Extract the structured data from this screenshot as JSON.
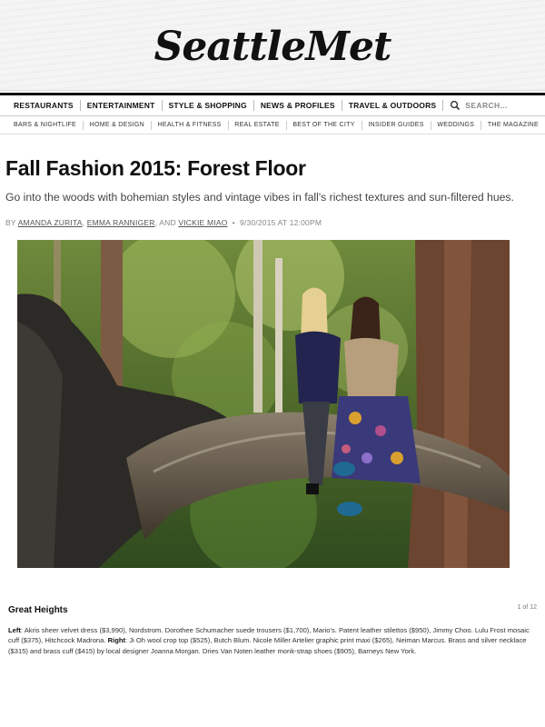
{
  "site": {
    "logo": "SeattleMet"
  },
  "primary_nav": {
    "items": [
      {
        "label": "RESTAURANTS"
      },
      {
        "label": "ENTERTAINMENT"
      },
      {
        "label": "STYLE & SHOPPING"
      },
      {
        "label": "NEWS & PROFILES"
      },
      {
        "label": "TRAVEL & OUTDOORS"
      }
    ],
    "search_placeholder": "SEARCH..."
  },
  "secondary_nav": {
    "items": [
      {
        "label": "BARS & NIGHTLIFE"
      },
      {
        "label": "HOME & DESIGN"
      },
      {
        "label": "HEALTH & FITNESS"
      },
      {
        "label": "REAL ESTATE"
      },
      {
        "label": "BEST OF THE CITY"
      },
      {
        "label": "INSIDER GUIDES"
      },
      {
        "label": "WEDDINGS"
      },
      {
        "label": "THE MAGAZINE"
      }
    ]
  },
  "article": {
    "title": "Fall Fashion 2015: Forest Floor",
    "dek": "Go into the woods with bohemian styles and vintage vibes in fall's richest textures and sun-filtered hues.",
    "byline_prefix": "BY",
    "authors": [
      "AMANDA ZURITA",
      "EMMA RANNIGER",
      "VICKIE MIAO"
    ],
    "author_sep": ",",
    "author_and": ", AND",
    "date": "9/30/2015 AT 12:00PM"
  },
  "slide": {
    "title": "Great Heights",
    "counter": "1 of 12",
    "left_label": "Left",
    "left_text": ": Akris sheer velvet dress ($3,990), Nordstrom. Dorothee Schumacher suede trousers ($1,700), Mario's. Patent leather stilettos ($950), Jimmy Choo. Lulu Frost mosaic cuff ($375), Hitchcock Madrona. ",
    "right_label": "Right",
    "right_text": ": Ji Oh wool crop top ($525), Butch Blum. Nicole Miller Artelier graphic print maxi ($265), Neiman Marcus. Brass and silver necklace ($315) and brass cuff ($415) by local designer Joanna Morgan. Dries Van Noten leather monk-strap shoes ($905), Barneys New York."
  },
  "colors": {
    "nav_rule": "#111111",
    "byline": "#888888",
    "foliage": "#5f7a2c"
  }
}
